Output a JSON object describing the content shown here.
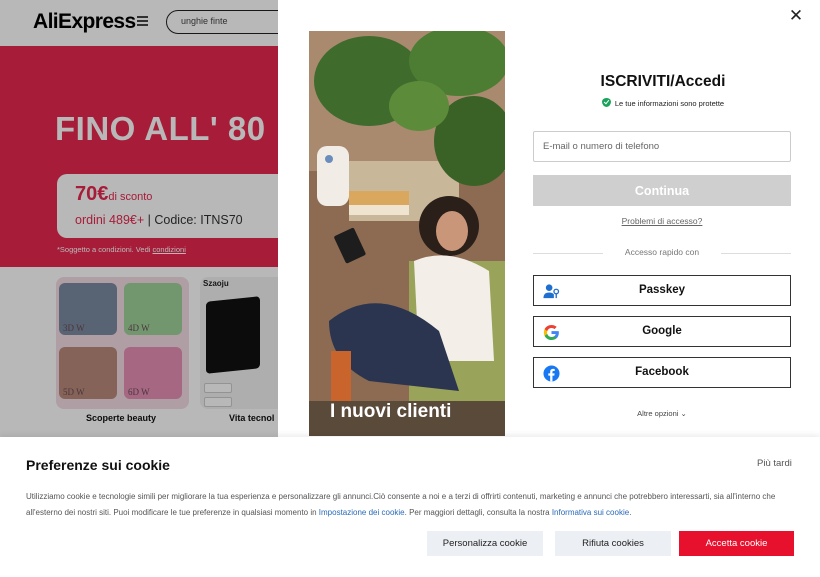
{
  "background": {
    "logo": "AliExpress",
    "search_value": "unghie finte",
    "banner_title": "FINO ALL' 80",
    "coupon": {
      "amount": "70€",
      "amount_suffix": "di sconto",
      "condition": "ordini 489€+",
      "separator": " | ",
      "code": "Codice: ITNS70"
    },
    "coupon_note": "*Soggetto a condizioni. Vedi",
    "coupon_note_link": "condizioni",
    "categories": [
      {
        "label": "Scoperte beauty",
        "tiles": [
          "3D W",
          "4D W",
          "5D W",
          "6D W"
        ]
      },
      {
        "label": "Vita tecnol",
        "brand": "Szaoju"
      }
    ]
  },
  "modal": {
    "close_icon": "close-icon",
    "promo_text": "I nuovi clienti",
    "title": "ISCRIVITI/Accedi",
    "secure_text": "Le tue informazioni sono protette",
    "email_placeholder": "E-mail o numero di telefono",
    "continue_label": "Continua",
    "access_problems": "Problemi di accesso?",
    "quick_access": "Accesso rapido con",
    "social_buttons": [
      {
        "label": "Passkey",
        "icon": "passkey-icon"
      },
      {
        "label": "Google",
        "icon": "google-icon"
      },
      {
        "label": "Facebook",
        "icon": "facebook-icon"
      }
    ],
    "more_options": "Altre opzioni"
  },
  "cookie_bar": {
    "title": "Preferenze sui cookie",
    "later": "Più tardi",
    "text_1": "Utilizziamo cookie e tecnologie simili per migliorare la tua esperienza e personalizzare gli annunci.Ciò consente a noi e a terzi di offrirti contenuti, marketing e annunci che potrebbero interessarti, sia all'interno che all'esterno dei nostri siti. Puoi modificare le tue preferenze in qualsiasi momento in ",
    "link_1": "Impostazione dei cookie",
    "text_2": ". Per maggiori dettagli, consulta la nostra ",
    "link_2": "Informativa sui cookie",
    "text_3": ".",
    "buttons": {
      "customize": "Personalizza cookie",
      "refuse": "Rifiuta cookies",
      "accept": "Accetta cookie"
    }
  },
  "colors": {
    "brand_red": "#e8274e",
    "accept_red": "#e8112d",
    "secure_green": "#1aa35c"
  }
}
